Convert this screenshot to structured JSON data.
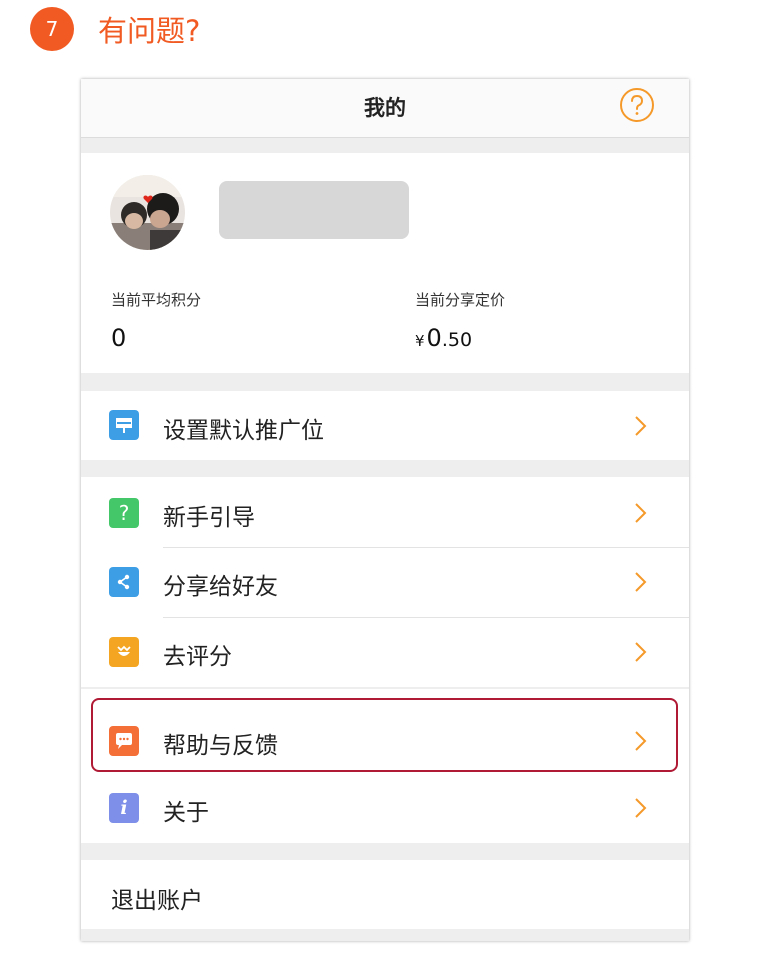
{
  "step": {
    "number": "7",
    "title": "有问题?"
  },
  "navbar": {
    "title": "我的",
    "help_icon": "question-circle-icon"
  },
  "profile": {
    "avatar": "user-avatar-photo",
    "stats": [
      {
        "label": "当前平均积分",
        "value": "0"
      },
      {
        "label": "当前分享定价",
        "currency": "¥",
        "integer": "0",
        "decimal": ".50"
      }
    ]
  },
  "menu": {
    "default_slot": {
      "label": "设置默认推广位",
      "icon": "billboard-icon",
      "color": "#3d9ee6"
    },
    "guide": {
      "label": "新手引导",
      "icon": "question-square-icon",
      "color": "#44c768"
    },
    "share": {
      "label": "分享给好友",
      "icon": "share-icon",
      "color": "#3d9ee6"
    },
    "rate": {
      "label": "去评分",
      "icon": "rating-icon",
      "color": "#f4a623"
    },
    "feedback": {
      "label": "帮助与反馈",
      "icon": "chat-bubble-icon",
      "color": "#f46e37"
    },
    "about": {
      "label": "关于",
      "icon": "info-icon",
      "color": "#7d8fe8"
    },
    "logout": {
      "label": "退出账户"
    }
  },
  "colors": {
    "accent": "#f15a22",
    "chevron": "#f59a2a",
    "highlight_border": "#b01a35"
  }
}
